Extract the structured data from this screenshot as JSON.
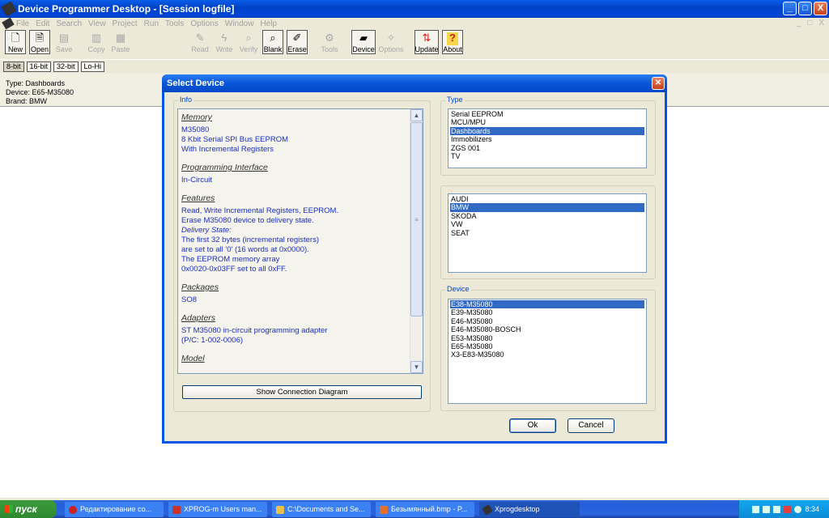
{
  "window": {
    "title": "Device Programmer Desktop - [Session logfile]",
    "controls": [
      "_",
      "□",
      "X"
    ]
  },
  "menu": [
    "File",
    "Edit",
    "Search",
    "View",
    "Project",
    "Run",
    "Tools",
    "Options",
    "Window",
    "Help"
  ],
  "mdi_controls": [
    "_",
    "□",
    "X"
  ],
  "toolbar": {
    "new": {
      "label": "New",
      "icon": "🗋"
    },
    "open": {
      "label": "Open",
      "icon": "🗎"
    },
    "save": {
      "label": "Save",
      "icon": "▤"
    },
    "copy": {
      "label": "Copy",
      "icon": "▥"
    },
    "paste": {
      "label": "Paste",
      "icon": "▦"
    },
    "read": {
      "label": "Read",
      "icon": "✎"
    },
    "write": {
      "label": "Write",
      "icon": "ϟ"
    },
    "verify": {
      "label": "Verify",
      "icon": "⌕"
    },
    "blank": {
      "label": "Blank",
      "icon": "⌕"
    },
    "erase": {
      "label": "Erase",
      "icon": "✐"
    },
    "tools": {
      "label": "Tools",
      "icon": "⚙"
    },
    "device": {
      "label": "Device",
      "icon": "▰"
    },
    "options": {
      "label": "Options",
      "icon": "✧"
    },
    "update": {
      "label": "Update",
      "icon": "⇅"
    },
    "about": {
      "label": "About",
      "icon": "?"
    }
  },
  "bitmode": [
    "8-bit",
    "16-bit",
    "32-bit",
    "Lo-Hi"
  ],
  "info_panel": {
    "type": "Type: Dashboards",
    "device": "Device: E65-M35080",
    "brand": "Brand: BMW"
  },
  "dialog": {
    "title": "Select Device",
    "info_label": "Info",
    "type_label": "Type",
    "device_label": "Device",
    "info": {
      "memory_h": "Memory",
      "memory_1": "M35080",
      "memory_2": "8 Kbit Serial SPI Bus EEPROM",
      "memory_3": "With Incremental Registers",
      "prog_h": "Programming Interface",
      "prog_1": "In-Circuit",
      "features_h": "Features",
      "features_1": "Read, Write Incremental Registers, EEPROM.",
      "features_2": "Erase M35080 device to delivery state.",
      "features_3": "Delivery State:",
      "features_4": "The first 32 bytes (incremental registers)",
      "features_5": "are set to all '0' (16 words at 0x0000).",
      "features_6": "The EEPROM memory array",
      "features_7": "0x0020-0x03FF set to all 0xFF.",
      "packages_h": "Packages",
      "packages_1": "SO8",
      "adapters_h": "Adapters",
      "adapters_1": "ST M35080 in-circuit programming adapter",
      "adapters_2": "(P/C: 1-002-0006)",
      "model_h": "Model"
    },
    "show_diagram": "Show Connection Diagram",
    "types": [
      "Serial EEPROM",
      "MCU/MPU",
      "Dashboards",
      "Immobilizers",
      "ZGS 001",
      "TV"
    ],
    "types_selected": 2,
    "brands": [
      "AUDI",
      "BMW",
      "SKODA",
      "VW",
      "SEAT"
    ],
    "brands_selected": 1,
    "devices": [
      "E38-M35080",
      "E39-M35080",
      "E46-M35080",
      "E46-M35080-BOSCH",
      "E53-M35080",
      "E65-M35080",
      "X3-E83-M35080"
    ],
    "devices_selected": 0,
    "ok": "Ok",
    "cancel": "Cancel"
  },
  "taskbar": {
    "start": "пуск",
    "tasks": [
      {
        "label": "Редактирование со...",
        "color": "#cc2222"
      },
      {
        "label": "XPROG-m Users man...",
        "color": "#c8332a"
      },
      {
        "label": "C:\\Documents and Se...",
        "color": "#e8c04a"
      },
      {
        "label": "Безымянный.bmp - P...",
        "color": "#e07030"
      },
      {
        "label": "Xprogdesktop",
        "color": "#333333"
      }
    ],
    "clock": "8:34"
  }
}
